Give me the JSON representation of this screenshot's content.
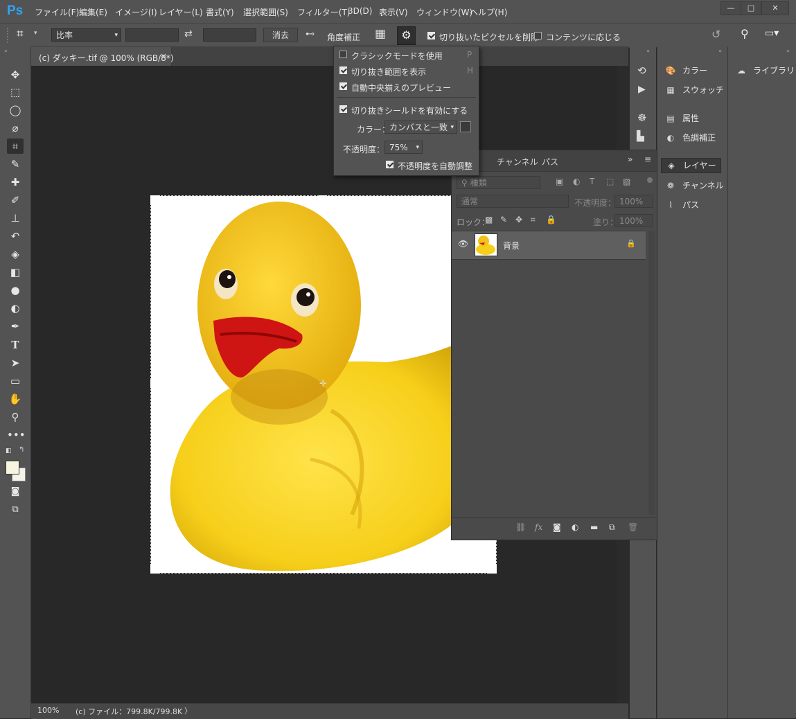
{
  "app": {
    "logo": "Ps"
  },
  "menu": [
    "ファイル(F)",
    "編集(E)",
    "イメージ(I)",
    "レイヤー(L)",
    "書式(Y)",
    "選択範囲(S)",
    "フィルター(T)",
    "3D(D)",
    "表示(V)",
    "ウィンドウ(W)",
    "ヘルプ(H)"
  ],
  "window_controls": {
    "minimize": "—",
    "maximize": "□",
    "close": "✕"
  },
  "options": {
    "ratio_value": "比率",
    "width_value": "",
    "height_value": "",
    "clear_label": "消去",
    "straighten_label": "角度補正",
    "delete_pixels_label": "切り抜いたピクセルを削除",
    "content_aware_label": "コンテンツに応じる",
    "delete_pixels_checked": true,
    "content_aware_checked": false
  },
  "document": {
    "tab_title": "(c) ダッキー.tif @ 100% (RGB/8*)",
    "tab_close": "×",
    "zoom": "100%",
    "file_info": "(c) ファイル：799.8K/799.8K"
  },
  "crop_menu": {
    "items": [
      {
        "label": "クラシックモードを使用",
        "shortcut": "P",
        "checked": false
      },
      {
        "label": "切り抜き範囲を表示",
        "shortcut": "H",
        "checked": true
      },
      {
        "label": "自動中央揃えのプレビュー",
        "shortcut": "",
        "checked": true
      },
      {
        "label": "切り抜きシールドを有効にする",
        "shortcut": "",
        "checked": true
      }
    ],
    "color_label": "カラー：",
    "color_value": "カンバスと一致",
    "opacity_label": "不透明度：",
    "opacity_value": "75%",
    "auto_opacity_label": "不透明度を自動調整",
    "auto_opacity_checked": true
  },
  "layers_panel": {
    "tabs": [
      "チャンネル",
      "パス"
    ],
    "filter_placeholder": "種類",
    "blend_mode": "通常",
    "opacity_label": "不透明度：",
    "opacity_value": "100%",
    "lock_label": "ロック：",
    "fill_label": "塗り：",
    "fill_value": "100%",
    "layers": [
      {
        "name": "背景",
        "visible": true,
        "locked": true
      }
    ]
  },
  "dock": {
    "group1": [
      {
        "label": "カラー",
        "icon": "palette-icon"
      },
      {
        "label": "スウォッチ",
        "icon": "grid-icon"
      }
    ],
    "group2": [
      {
        "label": "属性",
        "icon": "properties-icon"
      },
      {
        "label": "色調補正",
        "icon": "adjustments-icon"
      }
    ],
    "group3": [
      {
        "label": "レイヤー",
        "icon": "layers-icon"
      },
      {
        "label": "チャンネル",
        "icon": "channels-icon"
      },
      {
        "label": "パス",
        "icon": "paths-icon"
      }
    ],
    "library": "ライブラリ"
  }
}
